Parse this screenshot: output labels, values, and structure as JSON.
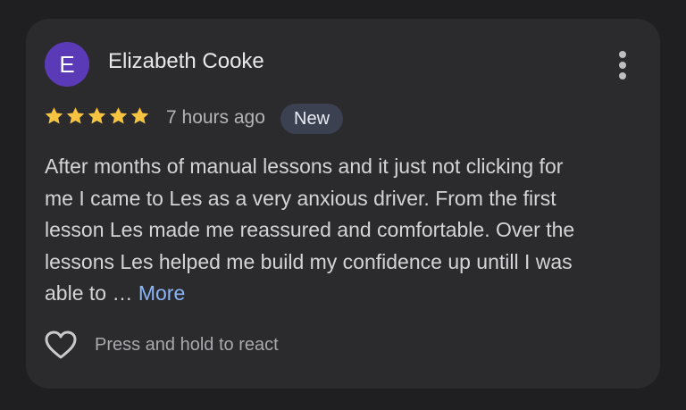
{
  "review": {
    "avatar_letter": "E",
    "reviewer_name": "Elizabeth Cooke",
    "rating": 5,
    "max_rating": 5,
    "time_ago": "7 hours ago",
    "badge": "New",
    "text_lines": [
      "After months of manual lessons and it just not clicking for",
      "me I came to Les as a very anxious driver. From the first",
      "lesson Les made me reassured and comfortable. Over the",
      "lessons Les helped me build my confidence up untill I was",
      "able to … "
    ],
    "more_label": "More",
    "react_label": "Press and hold to react"
  },
  "icons": {
    "menu": "more-vert-icon",
    "star": "star-icon",
    "heart": "heart-outline-icon"
  },
  "colors": {
    "background": "#1f1f21",
    "card": "#2b2b2e",
    "avatar": "#5b3ab8",
    "star": "#f6c342",
    "link": "#8ab4f8",
    "badge_bg": "#3b4150"
  }
}
